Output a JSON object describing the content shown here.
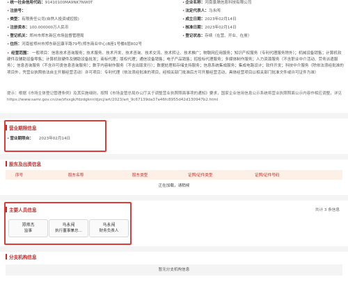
{
  "registration": {
    "credit_code_label": "统一社会信用代码：",
    "credit_code": "91410100MA9NK7NW0T",
    "name_label": "企业名称：",
    "name": "河南景晟信息科技有限公司",
    "reg_no_label": "注册号：",
    "legal_rep_label": "法定代表人：",
    "legal_rep": "马永闯",
    "type_label": "类型：",
    "type": "有限责任公司(自然人投资或控股)",
    "established_label": "成立日期：",
    "established": "2023年02月14日",
    "capital_label": "注册资本：",
    "capital": "100.000000万人民币",
    "approval_label": "核准日期：",
    "approval": "2023年02月14日",
    "authority_label": "登记机关：",
    "authority": "郑州市郑东新区市场监督管理局",
    "status_label": "登记状态：",
    "status": "存续（在营、开业、在册）",
    "address_label": "住所：",
    "address": "河南省郑州市郑东新区康平路79号(郑东商业中心)B座1号楼8层802号",
    "scope_label": "经营范围：",
    "scope": "一般项目：信息技术咨询服务；技术服务、技术开发、技术咨询、技术交流、技术转让、技术推广；物联网应用服务；知识产权服务（专利代理服务除外）；机械设备销售；计算机软硬件及辅助设备零售；计算机软硬件及辅助设备批发；商标代理；版权代理；通信设备销售；电子产品销售；招投标代理服务；多媒体制作服务；人力资源服务（不含职业中介活动、劳务派遣服务）；信息咨询服务（不含许可类信息咨询服务）；数字内容制作服务（不含出版发行）；数据处理和存储支持服务；信息系统集成服务；集成电路设计；软件开发；科技中介服务（除依法须经批准的项目外，凭营业执照依法自主开展经营活动）许可项目：专利代理（依法须经批准的项目，经相关部门批准后方可开展经营活动，具体经营项目以相关部门批准文件或许可证件为准）",
    "tip": "提示：根据《市场主体登记管理条例》及其实施细则，按照《市场监管总局办公厅关于调整营业执照照面事项的通知》要求，国家企业信用信息公示系统将营业执照照面公示内容作相应调整，详见https://www.samr.gov.cn/zw/zfxxgk/fdzdgknr/djzcj/art/2023/art_9c67139da37a46fc8955d42d130947b2.html"
  },
  "term": {
    "title": "营业期限信息",
    "expiry_label": "营业期限自：",
    "expiry": "2023年02月14日"
  },
  "shareholders": {
    "title": "股东及出资信息",
    "columns": [
      "序号",
      "股东名称",
      "股东类型",
      "证照/证件类型",
      "证照/证件号码"
    ],
    "loading": "正在加载，请稍候"
  },
  "personnel": {
    "title": "主要人员信息",
    "count": "共计 3 条信息",
    "people": [
      {
        "name": "郑帅杰",
        "role": "监事"
      },
      {
        "name": "马永闯",
        "role": "执行董事兼总..."
      },
      {
        "name": "马永闯",
        "role": "财务负责人"
      }
    ]
  },
  "branches": {
    "title": "分支机构信息",
    "empty": "暂无分支机构信息"
  },
  "colors": {
    "accent": "#c62828",
    "highlight_border": "#e53935",
    "table_header_bg": "#fdf1e7"
  }
}
